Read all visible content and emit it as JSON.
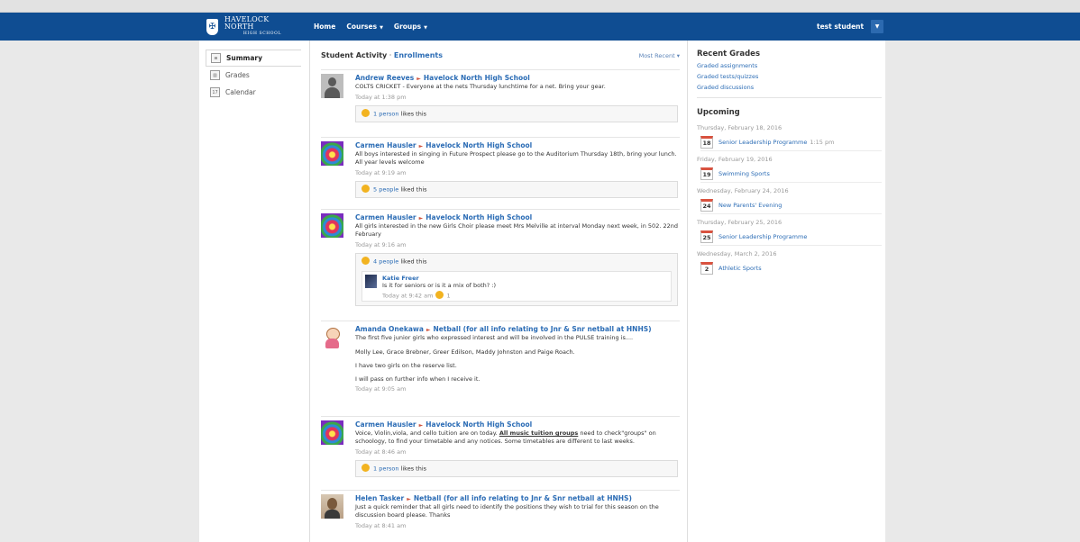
{
  "header": {
    "school_line1": "HAVELOCK NORTH",
    "school_line2": "HIGH SCHOOL",
    "nav": [
      {
        "label": "Home"
      },
      {
        "label": "Courses"
      },
      {
        "label": "Groups"
      }
    ],
    "user": "test student",
    "icons": {
      "crest": "school-crest-icon",
      "user_menu": "chevron-down-icon"
    }
  },
  "sidebar": {
    "items": [
      {
        "label": "Summary",
        "icon": "summary-icon"
      },
      {
        "label": "Grades",
        "icon": "grades-icon"
      },
      {
        "label": "Calendar",
        "icon": "calendar-icon"
      }
    ]
  },
  "feed": {
    "title": "Student Activity",
    "separator": "·",
    "enrollments": "Enrollments",
    "sort": "Most Recent",
    "posts": [
      {
        "author": "Andrew Reeves",
        "group": "Havelock North High School",
        "text": "COLTS CRICKET - Everyone at the nets Thursday lunchtime for a net. Bring your gear.",
        "time": "Today at 1:38 pm",
        "likes_count": "1 person",
        "likes_suffix": "likes this"
      },
      {
        "author": "Carmen Hausler",
        "group": "Havelock North High School",
        "text": "All boys interested in singing in Future Prospect please go to the Auditorium Thursday 18th, bring your lunch. All year levels welcome",
        "time": "Today at 9:19 am",
        "likes_count": "5 people",
        "likes_suffix": "liked this"
      },
      {
        "author": "Carmen Hausler",
        "group": "Havelock North High School",
        "text": "All girls interested in the new Girls Choir please meet Mrs Melville at interval Monday next week, in 502. 22nd February",
        "time": "Today at 9:16 am",
        "likes_count": "4 people",
        "likes_suffix": "liked this",
        "comment": {
          "author": "Katie Freer",
          "text": "Is it for seniors or is it a mix of both? :)",
          "time": "Today at 9:42 am",
          "likes": "1"
        }
      },
      {
        "author": "Amanda Onekawa",
        "group": "Netball (for all info relating to Jnr & Snr netball at HNHS)",
        "text": "The first five junior girls who expressed interest and will be involved in the PULSE training is....",
        "para1": "Molly Lee, Grace Brebner, Greer Edilson, Maddy Johnston and Paige Roach.",
        "para2": "I have two girls on the reserve list.",
        "para3": "I will pass on further info when I receive it.",
        "time": "Today at 9:05 am"
      },
      {
        "author": "Carmen Hausler",
        "group": "Havelock North High School",
        "text_before": "Voice, Violin,viola, and cello tuition are on today.  ",
        "text_bold": "All music tuition groups",
        "text_after": " need to check\"groups\" on schoology, to find your timetable and any notices. Some timetables are different to last weeks.",
        "time": "Today at 8:46 am",
        "likes_count": "1 person",
        "likes_suffix": "likes this"
      },
      {
        "author": "Helen Tasker",
        "group": "Netball (for all info relating to Jnr & Snr netball at HNHS)",
        "text": "Just a quick reminder that all girls need to identify the positions they wish to trial for this season on the discussion board please.  Thanks",
        "time": "Today at 8:41 am"
      }
    ]
  },
  "right": {
    "recent_title": "Recent Grades",
    "recent_links": [
      "Graded assignments",
      "Graded tests/quizzes",
      "Graded discussions"
    ],
    "upcoming_title": "Upcoming",
    "upcoming": [
      {
        "date": "Thursday, February 18, 2016",
        "day": "18",
        "event": "Senior Leadership Programme",
        "time": "1:15 pm"
      },
      {
        "date": "Friday, February 19, 2016",
        "day": "19",
        "event": "Swimming Sports",
        "time": ""
      },
      {
        "date": "Wednesday, February 24, 2016",
        "day": "24",
        "event": "New Parents' Evening",
        "time": ""
      },
      {
        "date": "Thursday, February 25, 2016",
        "day": "25",
        "event": "Senior Leadership Programme",
        "time": ""
      },
      {
        "date": "Wednesday, March 2, 2016",
        "day": "2",
        "event": "Athletic Sports",
        "time": ""
      }
    ]
  },
  "colors": {
    "brand": "#0f4d92",
    "link": "#2b6cb5",
    "accent": "#d0543e"
  }
}
